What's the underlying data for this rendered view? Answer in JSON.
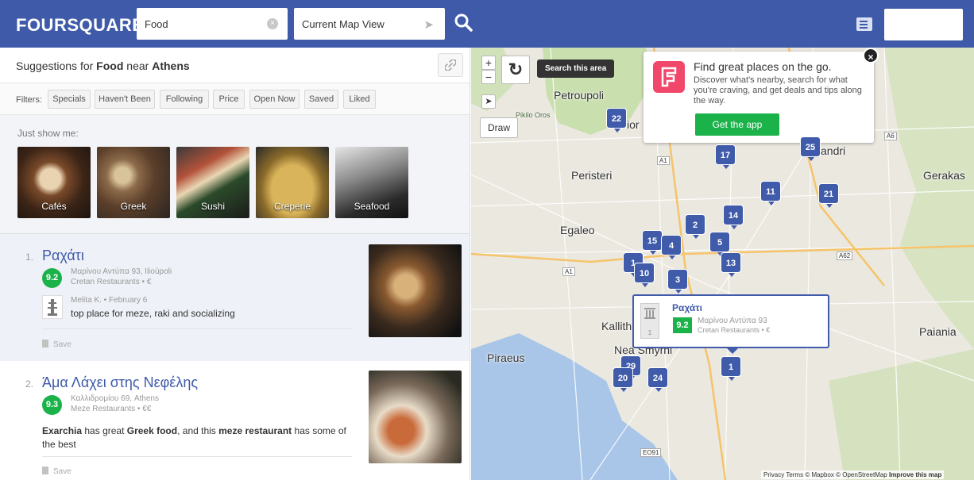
{
  "header": {
    "logo": "FOURSQUARE",
    "search_value": "Food",
    "near_value": "Current Map View",
    "brand_color": "#3e5aa8"
  },
  "suggestions": {
    "prefix": "Suggestions for ",
    "query": "Food",
    "near_word": " near ",
    "location": "Athens"
  },
  "filters": {
    "label": "Filters:",
    "chips": [
      "Specials",
      "Haven't Been",
      "Following",
      "Price",
      "Open Now",
      "Saved",
      "Liked"
    ]
  },
  "just_show_me": {
    "label": "Just show me:",
    "tiles": [
      "Cafés",
      "Greek",
      "Sushi",
      "Creperie",
      "Seafood"
    ]
  },
  "venues": [
    {
      "rank": "1.",
      "name": "Ραχάτι",
      "score": "9.2",
      "address": "Μαρίνου Αντύπα 93, Ilioúpoli",
      "category": "Cretan Restaurants",
      "price": "€",
      "tip_author": "Melita K. • February 6",
      "tip_text": "top place for meze, raki and socializing",
      "save_label": "Save"
    },
    {
      "rank": "2.",
      "name": "Άμα Λάχει στης Νεφέλης",
      "score": "9.3",
      "address": "Καλλιδρομίου 69, Athens",
      "category": "Meze Restaurants",
      "price": "€€",
      "tip_part1": "Exarchia",
      "tip_part2": " has great ",
      "tip_part3": "Greek food",
      "tip_part4": ", and this ",
      "tip_part5": "meze restaurant",
      "tip_part6": " has some of the best",
      "save_label": "Save"
    }
  ],
  "map": {
    "search_area": "Search this area",
    "draw": "Draw",
    "zoom_in": "+",
    "zoom_out": "−",
    "places": {
      "petroupoli": "Petroupoli",
      "pikilo": "Pikilo Oros",
      "peristeri": "Peristeri",
      "egaleo": "Egaleo",
      "kallith": "Kallith",
      "nea_smyrni": "Nea Smyrni",
      "piraeus": "Piraeus",
      "gerakas": "Gerakas",
      "paiania": "Paiania",
      "andri": "andri",
      "ior": "ior"
    },
    "road_labels": [
      "A1",
      "A1",
      "A62",
      "A6",
      "EO91",
      "A6"
    ],
    "pins": [
      "22",
      "17",
      "25",
      "11",
      "21",
      "14",
      "2",
      "15",
      "4",
      "5",
      "1",
      "10",
      "3",
      "13",
      "1",
      "29",
      "20",
      "24"
    ],
    "promo": {
      "title": "Find great places on the go.",
      "text": "Discover what's nearby, search for what you're craving, and get deals and tips along the way.",
      "button": "Get the app",
      "close": "×"
    },
    "popup": {
      "title": "Ραχάτι",
      "score": "9.2",
      "address": "Μαρίνου Αντύπα 93",
      "category": "Cretan Restaurants • €",
      "rank": "1"
    },
    "attribution": {
      "privacy": "Privacy",
      "terms": "Terms",
      "mapbox": "© Mapbox",
      "osm": "© OpenStreetMap",
      "improve": "Improve this map"
    }
  }
}
